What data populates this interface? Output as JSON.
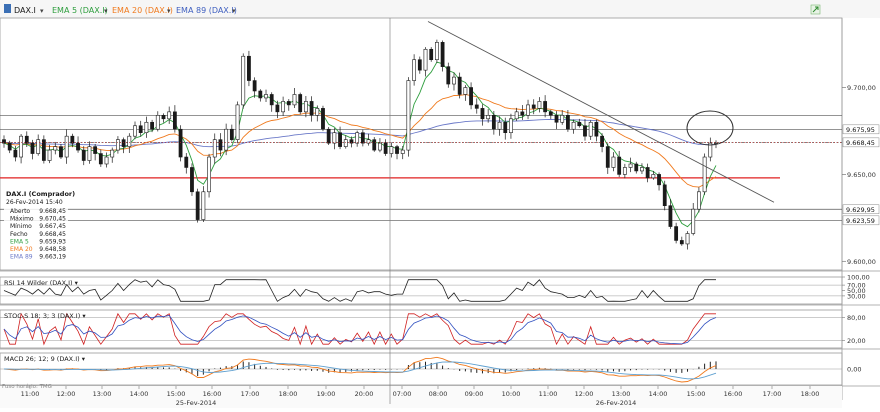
{
  "toolbar": {
    "symbol": "DAX.I",
    "ema5_label": "EMA 5 (DAX.I)",
    "ema20_label": "EMA 20 (DAX.I)",
    "ema89_label": "EMA 89 (DAX.I)"
  },
  "colors": {
    "candle_up": "#1a1a1a",
    "candle_down": "#1a1a1a",
    "ema5": "#2e9e3e",
    "ema20": "#f07a1e",
    "ema89": "#6a78c8",
    "horizontal_line": "#555555",
    "red_line": "#e02020",
    "stoch_k": "#d02020",
    "stoch_d": "#3050c0",
    "macd": "#f07a1e",
    "macd_signal": "#5fa0d0",
    "toolbar_symbol": "#1a1a1a",
    "toolbar_ema5": "#2e9e3e",
    "toolbar_ema20": "#f07a1e",
    "toolbar_ema89": "#4060c0"
  },
  "chart_data": {
    "type": "candlestick",
    "price_axis": {
      "range": [
        9595,
        9740
      ],
      "ticks": [
        "9.700,00",
        "9.650,00",
        "9.600,00"
      ],
      "tick_values": [
        9700,
        9650,
        9600
      ],
      "markers": [
        {
          "label": "9.675,95",
          "value": 9675.95
        },
        {
          "label": "9.668,45",
          "value": 9668.45
        },
        {
          "label": "9.629,95",
          "value": 9629.95
        },
        {
          "label": "9.623,59",
          "value": 9623.59
        }
      ]
    },
    "horizontal_lines": [
      9684,
      9675.95,
      9668.45,
      9629.95,
      9623.59
    ],
    "red_line_level": 9648,
    "x_axis": {
      "time_labels": [
        "11:00",
        "12:00",
        "13:00",
        "14:00",
        "15:00",
        "16:00",
        "17:00",
        "18:00",
        "19:00",
        "20:00",
        "07:00",
        "08:00",
        "09:00",
        "10:00",
        "11:00",
        "12:00",
        "13:00",
        "14:00",
        "15:00",
        "16:00",
        "17:00",
        "18:00"
      ],
      "date_labels": [
        "25-Fev-2014",
        "26-Fev-2014"
      ]
    },
    "info_box": {
      "title": "DAX.I (Comprador)",
      "datetime": "26-Fev-2014 15:40",
      "rows": [
        {
          "label": "Aberto",
          "value": "9.668,45"
        },
        {
          "label": "Máximo",
          "value": "9.670,45"
        },
        {
          "label": "Mínimo",
          "value": "9.667,45"
        },
        {
          "label": "Fecho",
          "value": "9.668,45"
        },
        {
          "label": "EMA 5",
          "value": "9.659,93"
        },
        {
          "label": "EMA 20",
          "value": "9.648,58"
        },
        {
          "label": "EMA 89",
          "value": "9.663,19"
        }
      ]
    },
    "trendline": {
      "from": {
        "time": "26-Fev-2014 08:00",
        "value": 9738
      },
      "to": {
        "time": "26-Fev-2014 16:00",
        "value": 9634
      }
    },
    "candle_close_path": [
      9668,
      9664,
      9660,
      9672,
      9668,
      9662,
      9670,
      9658,
      9664,
      9666,
      9660,
      9672,
      9668,
      9664,
      9658,
      9666,
      9662,
      9656,
      9660,
      9664,
      9670,
      9666,
      9672,
      9678,
      9674,
      9680,
      9676,
      9684,
      9682,
      9686,
      9676,
      9660,
      9654,
      9640,
      9624,
      9640,
      9660,
      9670,
      9664,
      9676,
      9670,
      9690,
      9718,
      9704,
      9698,
      9694,
      9696,
      9690,
      9686,
      9692,
      9690,
      9696,
      9686,
      9692,
      9684,
      9688,
      9676,
      9668,
      9674,
      9666,
      9670,
      9668,
      9674,
      9668,
      9670,
      9664,
      9668,
      9662,
      9666,
      9662,
      9664,
      9704,
      9716,
      9710,
      9722,
      9716,
      9726,
      9712,
      9702,
      9706,
      9696,
      9700,
      9690,
      9688,
      9682,
      9684,
      9676,
      9680,
      9674,
      9682,
      9686,
      9684,
      9690,
      9688,
      9692,
      9686,
      9684,
      9680,
      9684,
      9676,
      9680,
      9678,
      9672,
      9680,
      9672,
      9666,
      9654,
      9660,
      9650,
      9654,
      9656,
      9652,
      9654,
      9648,
      9650,
      9644,
      9632,
      9620,
      9612,
      9610,
      9616,
      9630,
      9640,
      9660,
      9668,
      9668
    ],
    "ema5": "computed",
    "ema20": "computed",
    "ema89": "computed",
    "panels": [
      {
        "name": "rsi",
        "label": "RSI 14 Wilder (DAX.I)",
        "range": [
          0,
          100
        ],
        "ticks": [
          {
            "label": "100,00",
            "value": 100
          },
          {
            "label": "70,00",
            "value": 70
          },
          {
            "label": "50,00",
            "value": 50
          },
          {
            "label": "30,00",
            "value": 30
          }
        ],
        "reference_lines": [
          70,
          30
        ]
      },
      {
        "name": "stoch",
        "label": "STOC-S 18; 3; 3 (DAX.I)",
        "range": [
          0,
          100
        ],
        "ticks": [
          {
            "label": "80,00",
            "value": 80
          },
          {
            "label": "20,00",
            "value": 20
          }
        ],
        "reference_lines": [
          80,
          20
        ]
      },
      {
        "name": "macd",
        "label": "MACD 26; 12; 9 (DAX.I)",
        "ticks": [
          {
            "label": "0,00",
            "value": 0
          }
        ]
      }
    ]
  },
  "footer": {
    "time_zone": "Fuso horário: TMG"
  }
}
